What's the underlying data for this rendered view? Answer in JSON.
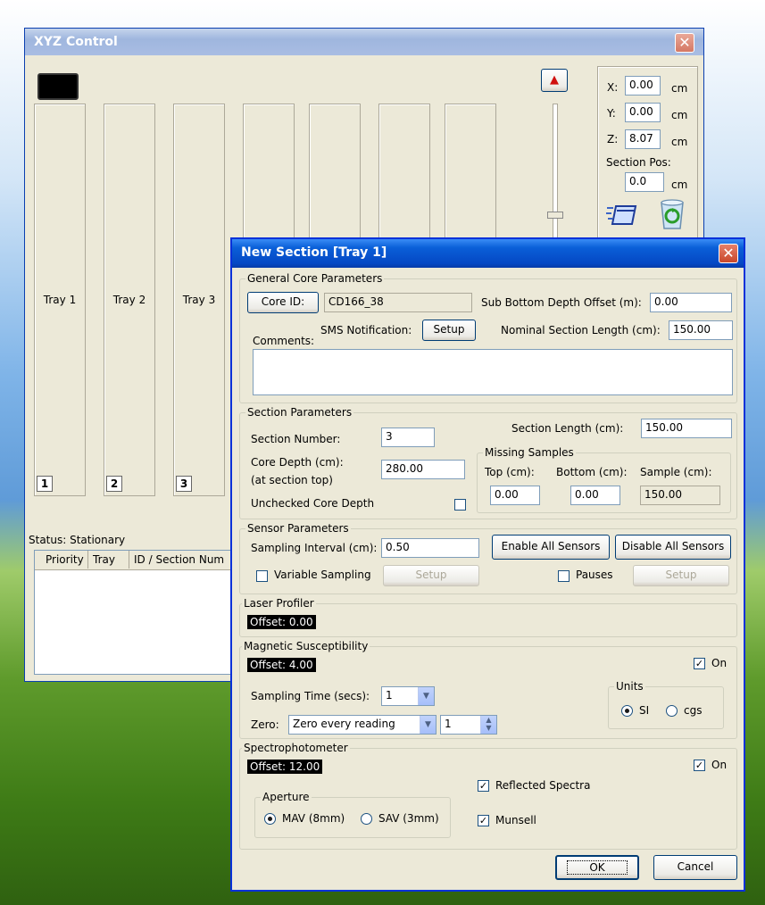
{
  "xyz": {
    "title": "XYZ Control",
    "close_glyph": "✕",
    "up_glyph": "▲",
    "trays": [
      {
        "label": "Tray 1",
        "num": "1"
      },
      {
        "label": "Tray 2",
        "num": "2"
      },
      {
        "label": "Tray 3",
        "num": "3"
      },
      {
        "label": "",
        "num": ""
      },
      {
        "label": "",
        "num": ""
      },
      {
        "label": "",
        "num": ""
      },
      {
        "label": "",
        "num": ""
      }
    ],
    "coords": {
      "x_label": "X:",
      "x_value": "0.00",
      "y_label": "Y:",
      "y_value": "0.00",
      "z_label": "Z:",
      "z_value": "8.07",
      "unit": "cm",
      "section_pos_label": "Section Pos:",
      "section_pos_value": "0.0"
    },
    "status": "Status: Stationary",
    "table_headers": [
      "Priority",
      "Tray",
      "ID / Section Num"
    ]
  },
  "dialog": {
    "title": "New Section [Tray 1]",
    "close_glyph": "✕",
    "general": {
      "title": "General Core Parameters",
      "core_id_button": "Core ID:",
      "core_id_value": "CD166_38",
      "sbd_label": "Sub Bottom Depth Offset (m):",
      "sbd_value": "0.00",
      "sms_label": "SMS Notification:",
      "setup_button": "Setup",
      "nominal_label": "Nominal Section Length (cm):",
      "nominal_value": "150.00",
      "comments_label": "Comments:",
      "comments_value": ""
    },
    "section": {
      "title": "Section Parameters",
      "number_label": "Section Number:",
      "number_value": "3",
      "length_label": "Section Length (cm):",
      "length_value": "150.00",
      "core_depth_label": "Core Depth (cm):",
      "core_depth_sub": "(at section top)",
      "core_depth_value": "280.00",
      "unchecked_label": "Unchecked Core Depth",
      "missing": {
        "title": "Missing Samples",
        "top_label": "Top (cm):",
        "bottom_label": "Bottom (cm):",
        "sample_label": "Sample (cm):",
        "top_value": "0.00",
        "bottom_value": "0.00",
        "sample_value": "150.00"
      }
    },
    "sensor": {
      "title": "Sensor Parameters",
      "interval_label": "Sampling Interval (cm):",
      "interval_value": "0.50",
      "enable_button": "Enable All Sensors",
      "disable_button": "Disable All Sensors",
      "variable_label": "Variable Sampling",
      "setup_button": "Setup",
      "pauses_label": "Pauses",
      "pauses_setup_button": "Setup"
    },
    "laser": {
      "title": "Laser Profiler",
      "offset": "Offset: 0.00"
    },
    "magsus": {
      "title": "Magnetic Susceptibility",
      "offset": "Offset: 4.00",
      "on_label": "On",
      "sampling_label": "Sampling Time (secs):",
      "sampling_value": "1",
      "zero_label": "Zero:",
      "zero_value": "Zero every reading",
      "zero_count": "1",
      "units_title": "Units",
      "si_label": "SI",
      "cgs_label": "cgs"
    },
    "spectro": {
      "title": "Spectrophotometer",
      "offset": "Offset: 12.00",
      "on_label": "On",
      "reflected_label": "Reflected Spectra",
      "munsell_label": "Munsell",
      "aperture_title": "Aperture",
      "mav_label": "MAV (8mm)",
      "sav_label": "SAV (3mm)"
    },
    "ok_button": "OK",
    "cancel_button": "Cancel",
    "check_glyph": "✓"
  },
  "colors": {
    "titlebar": "#0a5fd8",
    "close": "#d9553a"
  }
}
